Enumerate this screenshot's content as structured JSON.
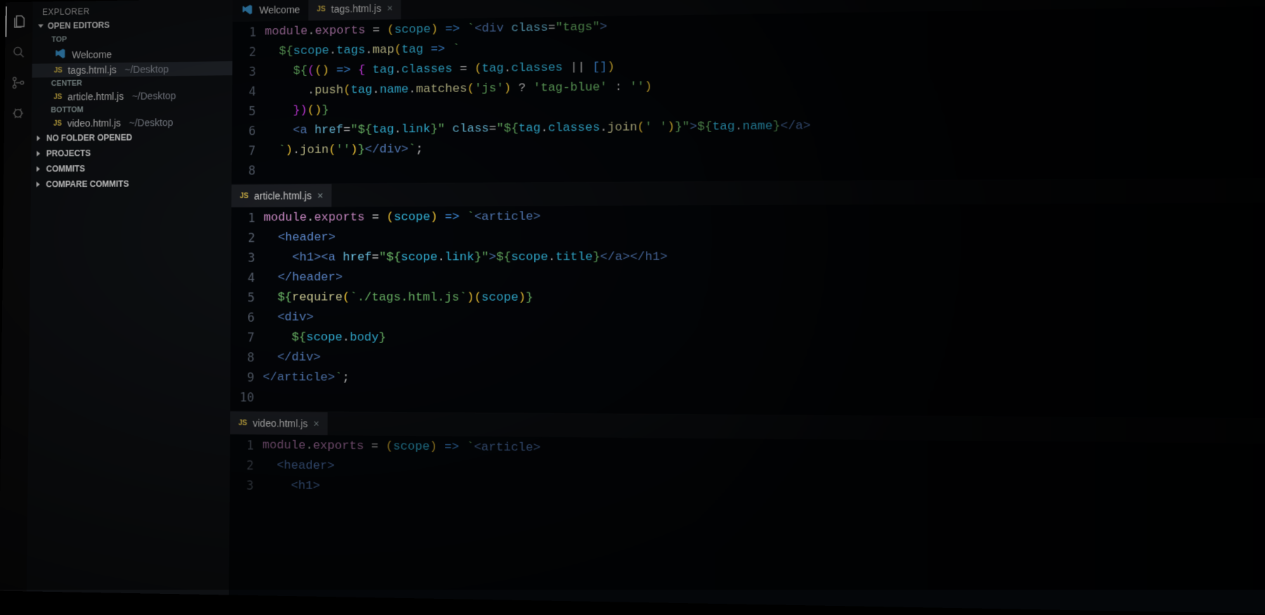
{
  "activity": {
    "items": [
      "files-icon",
      "search-icon",
      "source-control-icon",
      "debug-icon",
      "extensions-icon"
    ]
  },
  "sidebar": {
    "panel_title": "EXPLORER",
    "open_editors_label": "OPEN EDITORS",
    "groups": [
      {
        "name": "TOP",
        "files": [
          {
            "kind": "vscode",
            "label": "Welcome",
            "path": ""
          },
          {
            "kind": "js",
            "label": "tags.html.js",
            "path": "~/Desktop",
            "active": true
          }
        ]
      },
      {
        "name": "CENTER",
        "files": [
          {
            "kind": "js",
            "label": "article.html.js",
            "path": "~/Desktop"
          }
        ]
      },
      {
        "name": "BOTTOM",
        "files": [
          {
            "kind": "js",
            "label": "video.html.js",
            "path": "~/Desktop"
          }
        ]
      }
    ],
    "sections": [
      "NO FOLDER OPENED",
      "PROJECTS",
      "COMMITS",
      "COMPARE COMMITS"
    ]
  },
  "tabs_top": [
    {
      "kind": "vscode",
      "label": "Welcome",
      "closable": false
    },
    {
      "kind": "js",
      "label": "tags.html.js",
      "closable": true,
      "active": true
    }
  ],
  "editor1": {
    "tab": {
      "kind": "js",
      "label": "tags.html.js"
    },
    "lines": [
      1,
      2,
      3,
      4,
      5,
      6,
      7,
      8
    ],
    "code_html": "<span class='k'>module</span><span class='op'>.</span><span class='k'>exports</span> <span class='op'>=</span> <span class='yg'>(</span><span class='cy'>scope</span><span class='yg'>)</span> <span class='bl'>=&gt;</span> <span class='s'>`</span><span class='tg'>&lt;div</span> <span class='at'>class</span><span class='op'>=</span><span class='s'>\"tags\"</span><span class='tg'>&gt;</span>\n  <span class='s'>${</span><span class='cy'>scope</span><span class='op'>.</span><span class='cy'>tags</span><span class='op'>.</span><span class='fn'>map</span><span class='yg'>(</span><span class='cy'>tag</span> <span class='bl'>=&gt;</span> <span class='s'>`</span>\n    <span class='s'>${</span><span class='pk'>(</span><span class='yg'>(</span><span class='yg'>)</span> <span class='bl'>=&gt;</span> <span class='pk'>{</span> <span class='cy'>tag</span><span class='op'>.</span><span class='cy'>classes</span> <span class='op'>=</span> <span class='yg'>(</span><span class='cy'>tag</span><span class='op'>.</span><span class='cy'>classes</span> <span class='op'>||</span> <span class='bl'>[]</span><span class='yg'>)</span>\n      <span class='op'>.</span><span class='fn'>push</span><span class='yg'>(</span><span class='cy'>tag</span><span class='op'>.</span><span class='cy'>name</span><span class='op'>.</span><span class='fn'>matches</span><span class='yg'>(</span><span class='s'>'js'</span><span class='yg'>)</span> <span class='op'>?</span> <span class='s'>'tag-blue'</span> <span class='op'>:</span> <span class='s'>''</span><span class='yg'>)</span>\n    <span class='pk'>}</span><span class='pk'>)</span><span class='yg'>(</span><span class='yg'>)</span><span class='s'>}</span>\n    <span class='tg'>&lt;a</span> <span class='at'>href</span><span class='op'>=</span><span class='s'>\"${</span><span class='cy'>tag</span><span class='op'>.</span><span class='cy'>link</span><span class='s'>}\"</span> <span class='at'>class</span><span class='op'>=</span><span class='s'>\"${</span><span class='cy'>tag</span><span class='op'>.</span><span class='cy'>classes</span><span class='op'>.</span><span class='fn'>join</span><span class='yg'>(</span><span class='s'>' '</span><span class='yg'>)</span><span class='s'>}\"</span><span class='tg'>&gt;</span><span class='s'>${</span><span class='cy'>tag</span><span class='op'>.</span><span class='cy'>name</span><span class='s'>}</span><span class='tg'>&lt;/a&gt;</span>\n  <span class='s'>`</span><span class='yg'>)</span><span class='op'>.</span><span class='fn'>join</span><span class='yg'>(</span><span class='s'>''</span><span class='yg'>)</span><span class='s'>}</span><span class='tg'>&lt;/div&gt;</span><span class='s'>`</span><span class='op'>;</span>\n "
  },
  "editor2": {
    "tab": {
      "kind": "js",
      "label": "article.html.js"
    },
    "lines": [
      1,
      2,
      3,
      4,
      5,
      6,
      7,
      8,
      9,
      10
    ],
    "code_html": "<span class='k'>module</span><span class='op'>.</span><span class='k'>exports</span> <span class='op'>=</span> <span class='yg'>(</span><span class='cy'>scope</span><span class='yg'>)</span> <span class='bl'>=&gt;</span> <span class='s'>`</span><span class='tg'>&lt;article&gt;</span>\n  <span class='tg'>&lt;header&gt;</span>\n    <span class='tg'>&lt;h1&gt;&lt;a</span> <span class='at'>href</span><span class='op'>=</span><span class='s'>\"${</span><span class='cy'>scope</span><span class='op'>.</span><span class='cy'>link</span><span class='s'>}\"</span><span class='tg'>&gt;</span><span class='s'>${</span><span class='cy'>scope</span><span class='op'>.</span><span class='cy'>title</span><span class='s'>}</span><span class='tg'>&lt;/a&gt;&lt;/h1&gt;</span>\n  <span class='tg'>&lt;/header&gt;</span>\n  <span class='s'>${</span><span class='fn'>require</span><span class='yg'>(</span><span class='s'>`./tags.html.js`</span><span class='yg'>)</span><span class='yg'>(</span><span class='cy'>scope</span><span class='yg'>)</span><span class='s'>}</span>\n  <span class='tg'>&lt;div&gt;</span>\n    <span class='s'>${</span><span class='cy'>scope</span><span class='op'>.</span><span class='cy'>body</span><span class='s'>}</span>\n  <span class='tg'>&lt;/div&gt;</span>\n<span class='tg'>&lt;/article&gt;</span><span class='s'>`</span><span class='op'>;</span>\n "
  },
  "editor3": {
    "tab": {
      "kind": "js",
      "label": "video.html.js"
    },
    "lines": [
      1,
      2,
      3
    ],
    "code_html": "<span class='k'>module</span><span class='op'>.</span><span class='k'>exports</span> <span class='op'>=</span> <span class='yg'>(</span><span class='cy'>scope</span><span class='yg'>)</span> <span class='bl'>=&gt;</span> <span class='s'>`</span><span class='tg'>&lt;article&gt;</span>\n  <span class='tg'>&lt;header&gt;</span>\n    <span class='tg'>&lt;h1&gt;</span>"
  }
}
